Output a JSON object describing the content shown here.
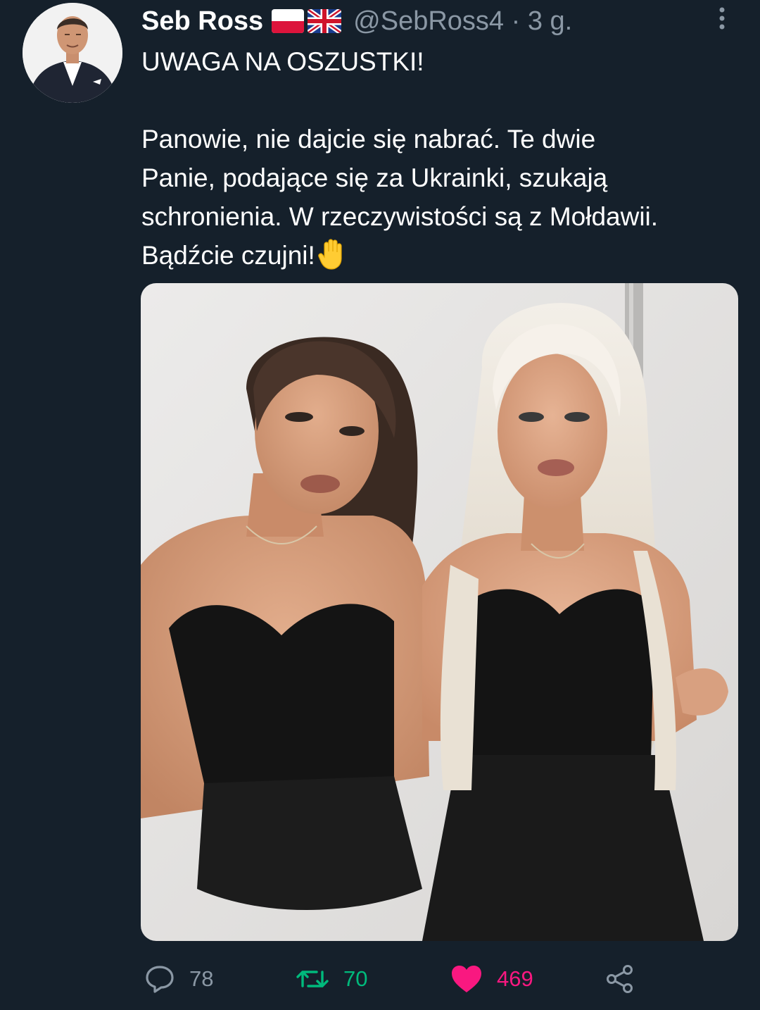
{
  "tweet": {
    "display_name": "Seb Ross",
    "handle": "@SebRoss4",
    "separator": "·",
    "time": "3 g.",
    "flags": [
      "poland-flag-icon",
      "uk-flag-icon"
    ],
    "text": {
      "headline": "UWAGA NA OSZUSTKI!",
      "body_lines": [
        "Panowie, nie dajcie się nabrać. Te dwie",
        "Panie, podające się za Ukrainki, szukają",
        "schronienia. W rzeczywistości są z Mołdawii.",
        "Bądźcie czujni!"
      ],
      "emoji": "raised-hand-icon"
    }
  },
  "actions": {
    "reply": {
      "icon": "reply-icon",
      "count": "78",
      "color": "#8b98a5"
    },
    "retweet": {
      "icon": "retweet-icon",
      "count": "70",
      "color": "#00ba7c",
      "active": true
    },
    "like": {
      "icon": "heart-icon",
      "count": "469",
      "color": "#f91880",
      "active": true
    },
    "share": {
      "icon": "share-icon",
      "color": "#8b98a5"
    }
  },
  "theme": {
    "background": "#15202b",
    "text_primary": "#ffffff",
    "text_secondary": "#8b98a5"
  }
}
